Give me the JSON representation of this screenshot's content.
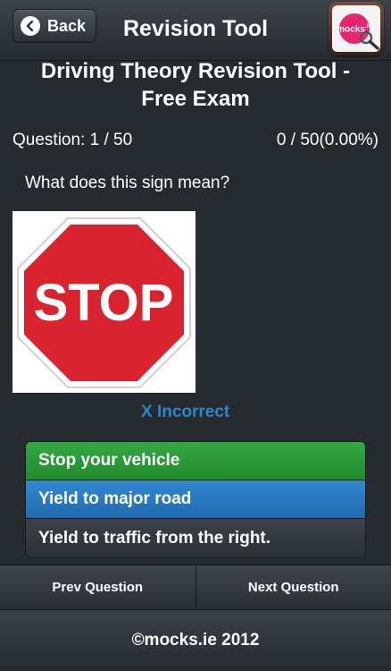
{
  "navbar": {
    "back_label": "Back",
    "title": "Revision Tool",
    "logo_text": "mocks",
    "logo_suffix": ".ie"
  },
  "page": {
    "title_line1": "Driving Theory Revision Tool -",
    "title_line2": "Free Exam",
    "question_count": "Question: 1 / 50",
    "score": "0 / 50(0.00%)",
    "question_text": "What does this sign mean?",
    "sign_text": "STOP",
    "feedback": "X  Incorrect"
  },
  "answers": [
    {
      "label": "Stop your vehicle",
      "state": "correct"
    },
    {
      "label": "Yield to major road",
      "state": "selected"
    },
    {
      "label": "Yield to traffic from the right.",
      "state": "plain"
    }
  ],
  "toolbar": {
    "prev_label": "Prev Question",
    "next_label": "Next Question"
  },
  "footer": {
    "text": "©mocks.ie 2012"
  },
  "colors": {
    "correct": "#1f8a2c",
    "selected": "#1f6ab0",
    "feedback": "#2e86c8",
    "stop_red": "#d9232e"
  },
  "icons": {
    "back": "chevron-left-icon",
    "sign": "stop-sign-icon"
  }
}
